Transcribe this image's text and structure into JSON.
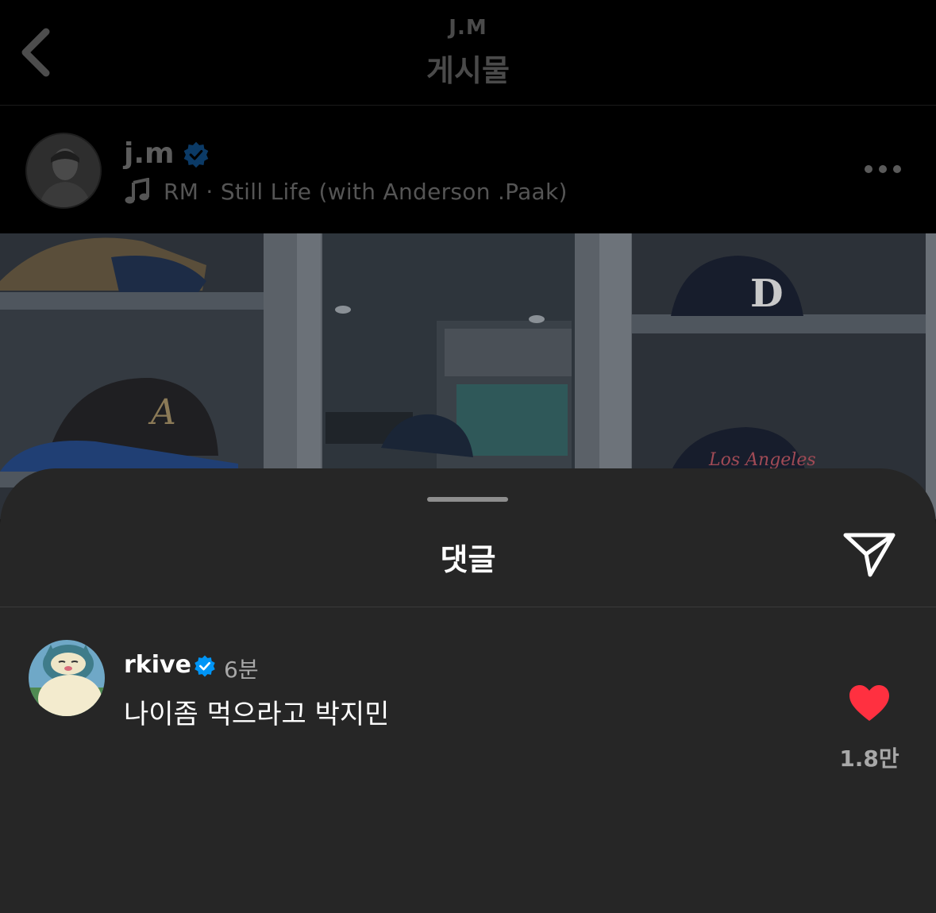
{
  "header": {
    "subtitle": "J.M",
    "title": "게시물"
  },
  "post": {
    "author": "j.m",
    "music": "RM · Still Life (with Anderson .Paak)"
  },
  "comments_sheet": {
    "title": "댓글",
    "comments": [
      {
        "username": "rkive",
        "time": "6분",
        "text": "나이좀 먹으라고 박지민",
        "likes": "1.8만"
      }
    ]
  },
  "colors": {
    "background": "#000000",
    "sheet": "#262626",
    "verified": "#0095f6",
    "like": "#ff3040",
    "secondary_text": "#a8a8a8"
  },
  "icons": [
    "back-chevron-icon",
    "verified-badge-icon",
    "music-note-icon",
    "more-dots-icon",
    "send-share-icon",
    "heart-icon"
  ]
}
